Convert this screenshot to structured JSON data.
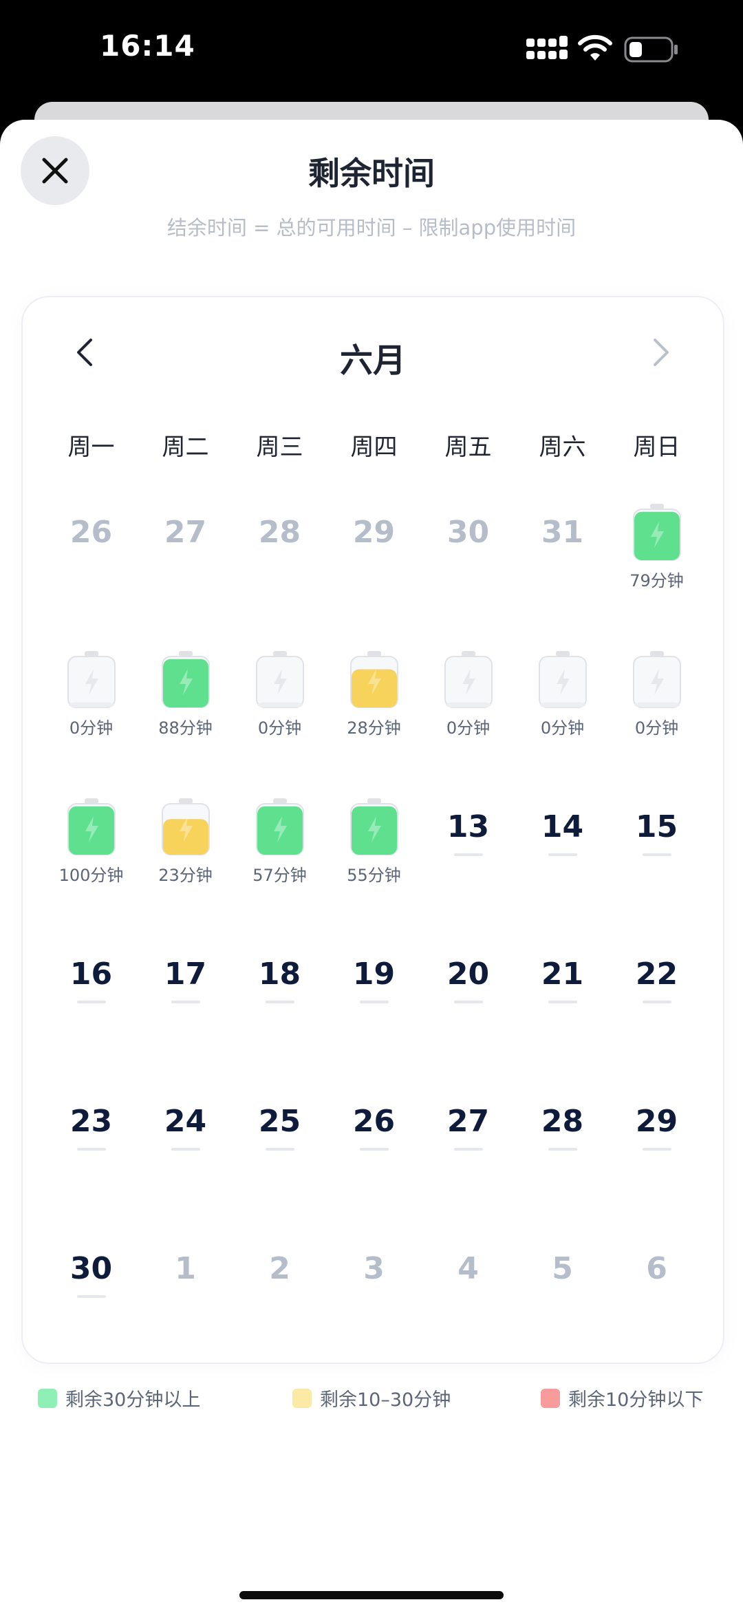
{
  "status_bar": {
    "time": "16:14"
  },
  "sheet": {
    "title": "剩余时间",
    "subtitle": "结余时间 = 总的可用时间 – 限制app使用时间"
  },
  "calendar": {
    "month": "六月",
    "weekdays": [
      "周一",
      "周二",
      "周三",
      "周四",
      "周五",
      "周六",
      "周日"
    ],
    "days": [
      {
        "num": "26",
        "state": "other"
      },
      {
        "num": "27",
        "state": "other"
      },
      {
        "num": "28",
        "state": "other"
      },
      {
        "num": "29",
        "state": "other"
      },
      {
        "num": "30",
        "state": "other"
      },
      {
        "num": "31",
        "state": "other"
      },
      {
        "state": "battery",
        "level": "green",
        "fill": 0.95,
        "minutes": "79分钟"
      },
      {
        "state": "battery",
        "level": "empty",
        "fill": 0.1,
        "minutes": "0分钟"
      },
      {
        "state": "battery",
        "level": "green",
        "fill": 0.95,
        "minutes": "88分钟"
      },
      {
        "state": "battery",
        "level": "empty",
        "fill": 0.1,
        "minutes": "0分钟"
      },
      {
        "state": "battery",
        "level": "yellow",
        "fill": 0.75,
        "minutes": "28分钟"
      },
      {
        "state": "battery",
        "level": "empty",
        "fill": 0.1,
        "minutes": "0分钟"
      },
      {
        "state": "battery",
        "level": "empty",
        "fill": 0.1,
        "minutes": "0分钟"
      },
      {
        "state": "battery",
        "level": "empty",
        "fill": 0.1,
        "minutes": "0分钟"
      },
      {
        "state": "battery",
        "level": "green",
        "fill": 0.95,
        "minutes": "100分钟"
      },
      {
        "state": "battery",
        "level": "yellow",
        "fill": 0.7,
        "minutes": "23分钟"
      },
      {
        "state": "battery",
        "level": "green",
        "fill": 0.95,
        "minutes": "57分钟"
      },
      {
        "state": "battery",
        "level": "green",
        "fill": 0.95,
        "minutes": "55分钟"
      },
      {
        "num": "13",
        "state": "future"
      },
      {
        "num": "14",
        "state": "future"
      },
      {
        "num": "15",
        "state": "future"
      },
      {
        "num": "16",
        "state": "future"
      },
      {
        "num": "17",
        "state": "future"
      },
      {
        "num": "18",
        "state": "future"
      },
      {
        "num": "19",
        "state": "future"
      },
      {
        "num": "20",
        "state": "future"
      },
      {
        "num": "21",
        "state": "future"
      },
      {
        "num": "22",
        "state": "future"
      },
      {
        "num": "23",
        "state": "future"
      },
      {
        "num": "24",
        "state": "future"
      },
      {
        "num": "25",
        "state": "future"
      },
      {
        "num": "26",
        "state": "future"
      },
      {
        "num": "27",
        "state": "future"
      },
      {
        "num": "28",
        "state": "future"
      },
      {
        "num": "29",
        "state": "future"
      },
      {
        "num": "30",
        "state": "future"
      },
      {
        "num": "1",
        "state": "next"
      },
      {
        "num": "2",
        "state": "next"
      },
      {
        "num": "3",
        "state": "next"
      },
      {
        "num": "4",
        "state": "next"
      },
      {
        "num": "5",
        "state": "next"
      },
      {
        "num": "6",
        "state": "next"
      }
    ]
  },
  "legend": [
    {
      "label": "剩余30分钟以上",
      "color": "#8ff0b6"
    },
    {
      "label": "剩余10–30分钟",
      "color": "#fde9a6"
    },
    {
      "label": "剩余10分钟以下",
      "color": "#f79b9b"
    }
  ],
  "colors": {
    "green": "#5fe08f",
    "yellow": "#f7d35c",
    "empty": "#f1f2f4"
  },
  "icons": [
    "close-icon",
    "chevron-left-icon",
    "chevron-right-icon",
    "battery-icon",
    "cellular-icon",
    "wifi-icon",
    "battery-status-icon"
  ]
}
